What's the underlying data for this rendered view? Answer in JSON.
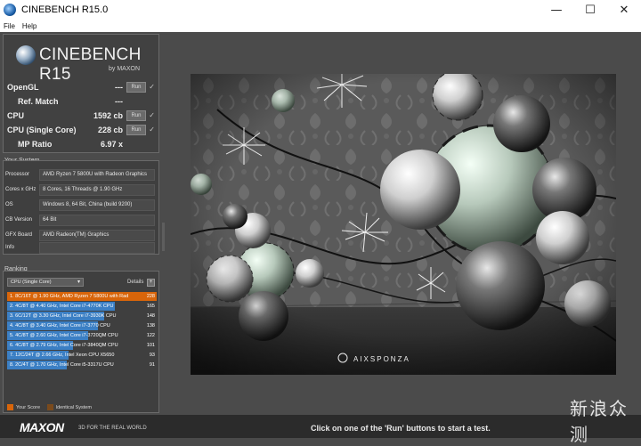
{
  "window": {
    "title": "CINEBENCH R15.0",
    "minimize": "—",
    "maximize": "☐",
    "close": "✕"
  },
  "menu": {
    "items": [
      "File",
      "Help"
    ]
  },
  "logo": {
    "name": "CINEBENCH R15",
    "by": "by MAXON"
  },
  "scores": [
    {
      "label": "OpenGL",
      "value": "---",
      "run": "Run",
      "check": "✓"
    },
    {
      "label": "Ref. Match",
      "value": "---"
    },
    {
      "label": "CPU",
      "value": "1592 cb",
      "run": "Run",
      "check": "✓"
    },
    {
      "label": "CPU (Single Core)",
      "value": "228 cb",
      "run": "Run",
      "check": "✓"
    },
    {
      "label": "MP Ratio",
      "value": "6.97 x"
    }
  ],
  "system": {
    "title": "Your System",
    "rows": [
      {
        "key": "Processor",
        "value": "AMD Ryzen 7 5800U with Radeon Graphics"
      },
      {
        "key": "Cores x GHz",
        "value": "8 Cores, 16 Threads @ 1.90 GHz"
      },
      {
        "key": "OS",
        "value": "Windows 8, 64 Bit, China (build 9200)"
      },
      {
        "key": "CB Version",
        "value": "64 Bit"
      },
      {
        "key": "GFX Board",
        "value": "AMD Radeon(TM) Graphics"
      },
      {
        "key": "Info",
        "value": ""
      }
    ]
  },
  "ranking": {
    "title": "Ranking",
    "select": "CPU (Single Core)",
    "details": "Details",
    "details_btn": "+",
    "rows": [
      {
        "text": "1. 8C/16T @ 1.90 GHz, AMD Ryzen 7 5800U with Rad",
        "score": "228",
        "fill": 1.0
      },
      {
        "text": "2. 4C/8T @ 4.40 GHz, Intel Core i7-4770K CPU",
        "score": "165",
        "fill": 0.72
      },
      {
        "text": "3. 6C/12T @ 3.30 GHz,  Intel Core i7-3930K CPU",
        "score": "148",
        "fill": 0.65
      },
      {
        "text": "4. 4C/8T @ 3.40 GHz,  Intel Core i7-3770 CPU",
        "score": "138",
        "fill": 0.61
      },
      {
        "text": "5. 4C/8T @ 2.60 GHz, Intel Core i7-3720QM CPU",
        "score": "122",
        "fill": 0.54
      },
      {
        "text": "6. 4C/8T @ 2.79 GHz,  Intel Core i7-3840QM CPU",
        "score": "101",
        "fill": 0.44
      },
      {
        "text": "7. 12C/24T @ 2.66 GHz, Intel Xeon CPU X5650",
        "score": "93",
        "fill": 0.41
      },
      {
        "text": "8. 2C/4T @ 1.70 GHz,  Intel Core i5-3317U CPU",
        "score": "91",
        "fill": 0.4
      }
    ],
    "legend_your": "Your Score",
    "legend_ident": "Identical System",
    "color_your": "#d8650a",
    "color_ident": "#7a4a1c"
  },
  "render": {
    "credit": "AIXSPONZA"
  },
  "footer": {
    "brand": "MAXON",
    "tagline": "3D FOR THE REAL WORLD",
    "status": "Click on one of the 'Run' buttons to start a test."
  },
  "watermark": "新浪众测"
}
